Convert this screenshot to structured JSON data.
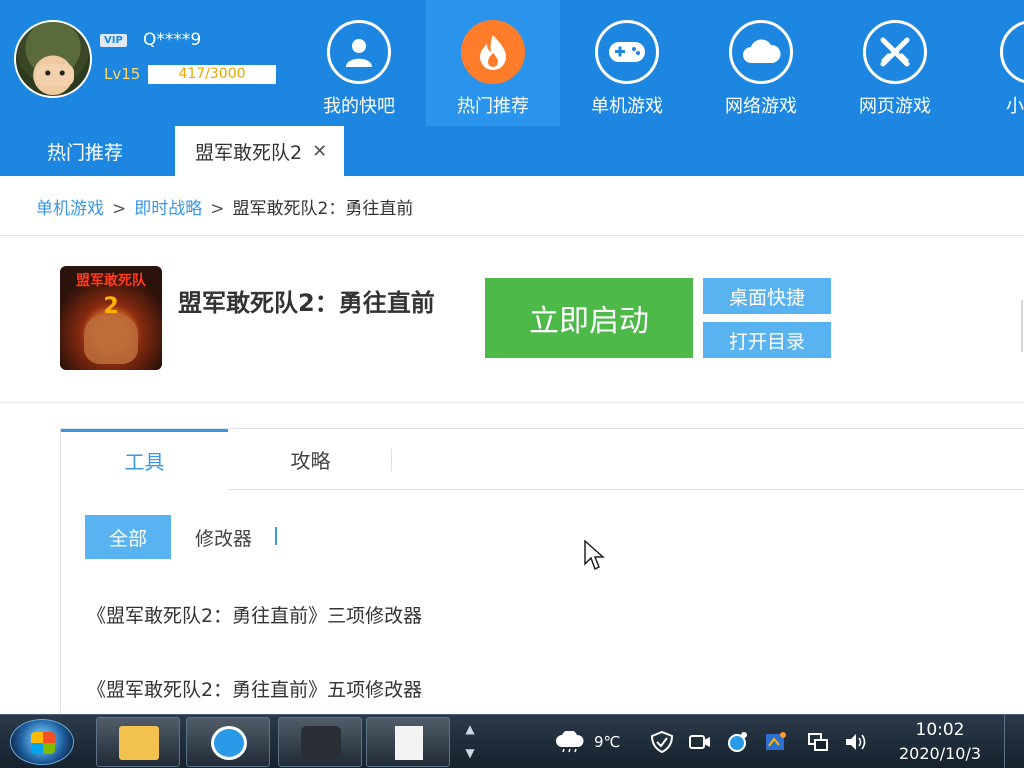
{
  "header": {
    "vip_badge": "VIP",
    "user_id": "Q****9",
    "level": "Lv15",
    "exp_text": "417/3000",
    "exp_fraction": 0.139,
    "nav": [
      {
        "label": "我的快吧",
        "icon": "user-icon"
      },
      {
        "label": "热门推荐",
        "icon": "flame-icon",
        "active": true
      },
      {
        "label": "单机游戏",
        "icon": "gamepad-icon"
      },
      {
        "label": "网络游戏",
        "icon": "cloud-icon"
      },
      {
        "label": "网页游戏",
        "icon": "crossed-swords-icon"
      },
      {
        "label": "小",
        "icon": "partial-icon"
      }
    ]
  },
  "tabs": {
    "home": "热门推荐",
    "game": "盟军敢死队2",
    "close_glyph": "✕"
  },
  "breadcrumb": {
    "items": [
      "单机游戏",
      "即时战略",
      "盟军敢死队2：勇往直前"
    ],
    "separator": ">"
  },
  "game": {
    "cover_title": "盟军敢死队",
    "cover_number": "2",
    "title": "盟军敢死队2：勇往直前",
    "launch_label": "立即启动",
    "desktop_shortcut_label": "桌面快捷",
    "open_dir_label": "打开目录"
  },
  "content": {
    "tabs": [
      "工具",
      "攻略"
    ],
    "filters": [
      "全部",
      "修改器"
    ],
    "items": [
      "《盟军敢死队2：勇往直前》三项修改器",
      "《盟军敢死队2：勇往直前》五项修改器"
    ]
  },
  "taskbar": {
    "weather": "9℃",
    "time": "10:02",
    "date": "2020/10/3"
  },
  "colors": {
    "brand_blue": "#1c86e0",
    "active_orange": "#ff7d2a",
    "launch_green": "#4cb948",
    "light_blue_button": "#59b3f0",
    "link_blue": "#3a97e7"
  }
}
